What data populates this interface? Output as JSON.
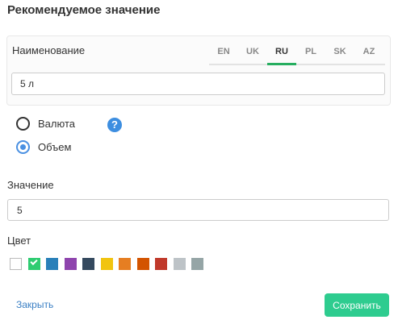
{
  "dialog": {
    "title": "Рекомендуемое значение",
    "name_label": "Наименование",
    "languages": [
      "EN",
      "UK",
      "RU",
      "PL",
      "SK",
      "AZ"
    ],
    "active_language": "RU",
    "name_value": "5 л",
    "radios": [
      {
        "label": "Валюта",
        "checked": false
      },
      {
        "label": "Объем",
        "checked": true
      }
    ],
    "help_icon_glyph": "?",
    "value_label": "Значение",
    "value_value": "5",
    "color_label": "Цвет",
    "colors": [
      "#ffffff",
      "#2ecc71",
      "#2980b9",
      "#8e44ad",
      "#34495e",
      "#f1c40f",
      "#e67e22",
      "#d35400",
      "#c0392b",
      "#bdc3c7",
      "#95a5a6"
    ],
    "selected_color_index": 1,
    "close_label": "Закрыть",
    "save_label": "Сохранить",
    "accent_color": "#27ae60"
  }
}
